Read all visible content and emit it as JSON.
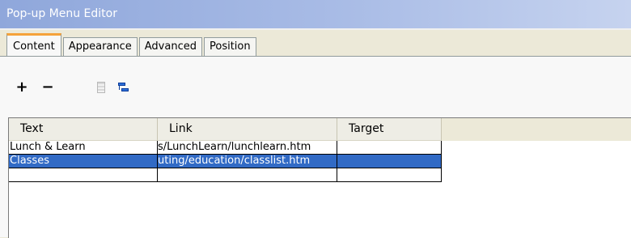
{
  "window": {
    "title": "Pop-up Menu Editor"
  },
  "tabs": [
    {
      "label": "Content",
      "active": true
    },
    {
      "label": "Appearance",
      "active": false
    },
    {
      "label": "Advanced",
      "active": false
    },
    {
      "label": "Position",
      "active": false
    }
  ],
  "toolbar": {
    "add_label": "+",
    "remove_label": "−",
    "move_up_icon": "move-up-icon",
    "indent_icon": "indent-icon"
  },
  "grid": {
    "columns": [
      "Text",
      "Link",
      "Target"
    ],
    "rows": [
      {
        "text": "Lunch & Learn",
        "link": "s/LunchLearn/lunchlearn.htm",
        "target": "",
        "selected": false
      },
      {
        "text": "Classes",
        "link": "uting/education/classlist.htm",
        "target": "",
        "selected": true
      },
      {
        "text": "",
        "link": "",
        "target": "",
        "selected": false
      }
    ]
  },
  "colors": {
    "selection": "#316AC5",
    "tab_accent": "#F5A23A",
    "title_bar": "#8FA7DB"
  }
}
